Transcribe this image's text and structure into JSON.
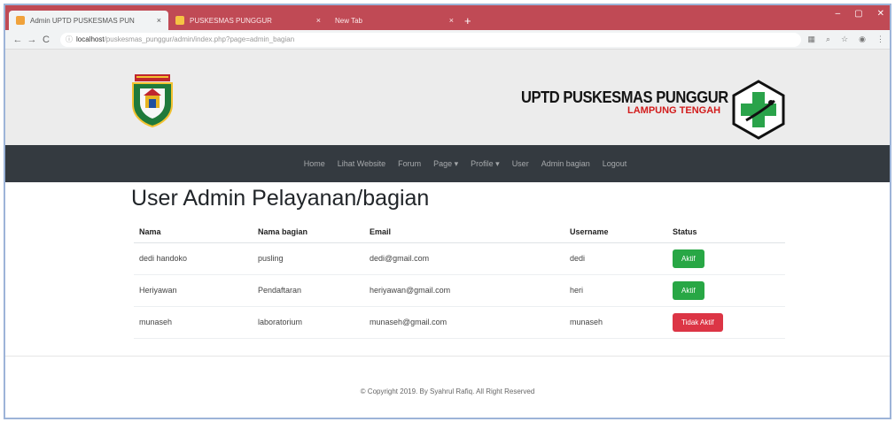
{
  "browser": {
    "tabs": [
      {
        "title": "Admin UPTD PUSKESMAS PUN",
        "favicon_color": "#f0a23b"
      },
      {
        "title": "PUSKESMAS PUNGGUR",
        "favicon_color": "#f6c343"
      },
      {
        "title": "New Tab",
        "favicon_color": ""
      }
    ],
    "tab_close": "×",
    "new_tab": "+",
    "window_controls": [
      "–",
      "▢",
      "✕"
    ],
    "url_host": "localhost",
    "url_path": "/puskesmas_punggur/admin/index.php?page=admin_bagian"
  },
  "header": {
    "brand_line1": "UPTD PUSKESMAS PUNGGUR",
    "brand_line2": "LAMPUNG TENGAH",
    "logo_left": "regency-crest-icon",
    "logo_right": "health-cross-icon"
  },
  "nav": {
    "items": [
      "Home",
      "Lihat Website",
      "Forum",
      "Page ▾",
      "Profile ▾",
      "User",
      "Admin bagian",
      "Logout"
    ]
  },
  "main": {
    "title": "User Admin Pelayanan/bagian",
    "columns": [
      "Nama",
      "Nama bagian",
      "Email",
      "Username",
      "Status"
    ],
    "rows": [
      {
        "nama": "dedi handoko",
        "bagian": "pusling",
        "email": "dedi@gmail.com",
        "username": "dedi",
        "status": "Aktif",
        "status_color": "#28a745"
      },
      {
        "nama": "Heriyawan",
        "bagian": "Pendaftaran",
        "email": "heriyawan@gmail.com",
        "username": "heri",
        "status": "Aktif",
        "status_color": "#28a745"
      },
      {
        "nama": "munaseh",
        "bagian": "laboratorium",
        "email": "munaseh@gmail.com",
        "username": "munaseh",
        "status": "Tidak Aktif",
        "status_color": "#dc3545"
      }
    ]
  },
  "footer": {
    "text": "© Copyright 2019. By Syahrul Rafiq. All Right Reserved"
  }
}
